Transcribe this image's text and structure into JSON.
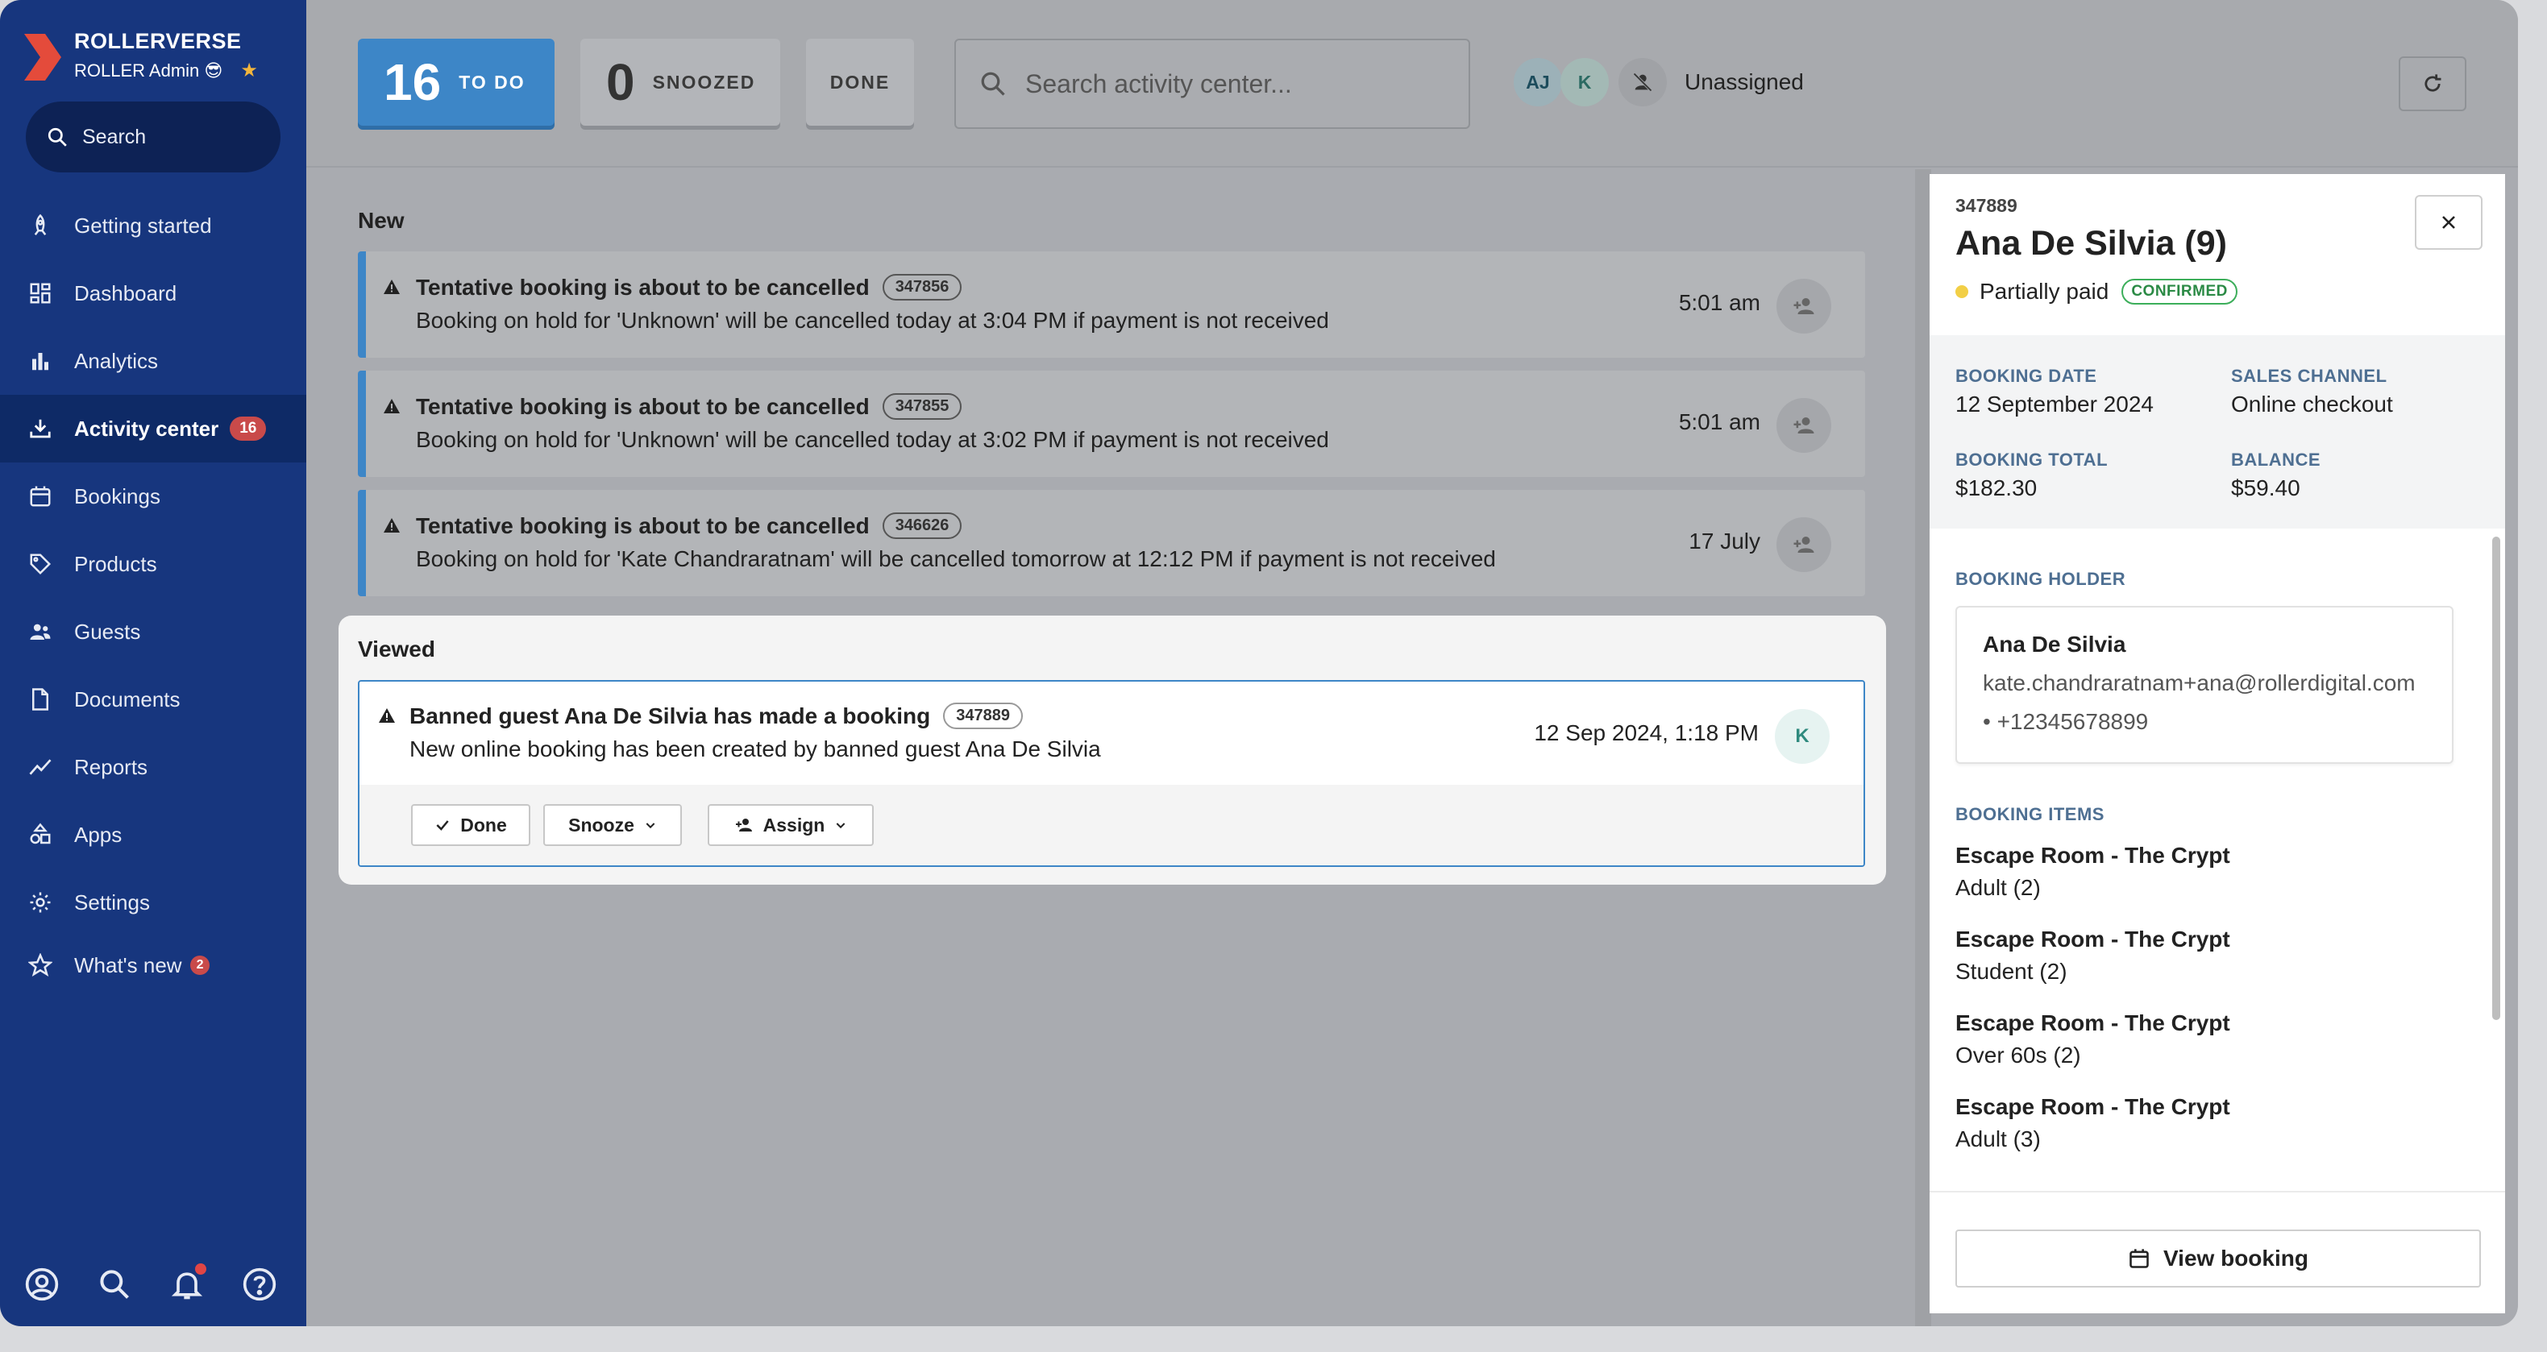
{
  "brand": {
    "name": "ROLLERVERSE",
    "role": "ROLLER Admin 😎",
    "star": "★",
    "accent": "#e44b3b"
  },
  "sidebar": {
    "search_label": "Search",
    "items": [
      {
        "label": "Getting started",
        "icon": "rocket-icon"
      },
      {
        "label": "Dashboard",
        "icon": "dashboard-icon"
      },
      {
        "label": "Analytics",
        "icon": "bar-chart-icon"
      },
      {
        "label": "Activity center",
        "icon": "download-tray-icon",
        "badge": "16",
        "active": true
      },
      {
        "label": "Bookings",
        "icon": "calendar-icon"
      },
      {
        "label": "Products",
        "icon": "tag-icon"
      },
      {
        "label": "Guests",
        "icon": "guests-icon"
      },
      {
        "label": "Documents",
        "icon": "document-icon"
      },
      {
        "label": "Reports",
        "icon": "trend-line-icon"
      },
      {
        "label": "Apps",
        "icon": "apps-icon"
      },
      {
        "label": "Settings",
        "icon": "gear-icon"
      },
      {
        "label": "What's new",
        "icon": "star-outline-icon",
        "badge": "2"
      }
    ],
    "bottom_icons": [
      "account-icon",
      "search-icon",
      "bell-icon",
      "help-icon"
    ]
  },
  "toolbar": {
    "todo": {
      "count": "16",
      "label": "TO DO"
    },
    "snoozed": {
      "count": "0",
      "label": "SNOOZED"
    },
    "done": {
      "label": "DONE"
    },
    "search_placeholder": "Search activity center...",
    "avatars": [
      "AJ",
      "K"
    ],
    "unassigned_label": "Unassigned"
  },
  "sections": {
    "new_title": "New",
    "viewed_title": "Viewed"
  },
  "new_items": [
    {
      "title": "Tentative booking is about to be cancelled",
      "id": "347856",
      "desc": "Booking on hold for 'Unknown' will be cancelled today at 3:04 PM if payment is not received",
      "time": "5:01 am"
    },
    {
      "title": "Tentative booking is about to be cancelled",
      "id": "347855",
      "desc": "Booking on hold for 'Unknown' will be cancelled today at 3:02 PM if payment is not received",
      "time": "5:01 am"
    },
    {
      "title": "Tentative booking is about to be cancelled",
      "id": "346626",
      "desc": "Booking on hold for 'Kate Chandraratnam' will be cancelled tomorrow at 12:12 PM if payment is not received",
      "time": "17 July"
    }
  ],
  "viewed_item": {
    "title": "Banned guest Ana De Silvia has made a booking",
    "id": "347889",
    "desc": "New online booking has been created by banned guest Ana De Silvia",
    "time": "12 Sep 2024, 1:18 PM",
    "assignee": "K",
    "actions": {
      "done": "Done",
      "snooze": "Snooze",
      "assign": "Assign"
    }
  },
  "panel": {
    "id": "347889",
    "name": "Ana De Silvia (9)",
    "payment_status": "Partially paid",
    "booking_status": "CONFIRMED",
    "summary": {
      "booking_date_label": "BOOKING DATE",
      "booking_date": "12 September 2024",
      "sales_channel_label": "SALES CHANNEL",
      "sales_channel": "Online checkout",
      "booking_total_label": "BOOKING TOTAL",
      "booking_total": "$182.30",
      "balance_label": "BALANCE",
      "balance": "$59.40"
    },
    "holder_label": "BOOKING HOLDER",
    "holder": {
      "name": "Ana De Silvia",
      "email": "kate.chandraratnam+ana@rollerdigital.com",
      "phone": "• +12345678899"
    },
    "items_label": "BOOKING ITEMS",
    "items": [
      {
        "name": "Escape Room - The Crypt",
        "detail": "Adult (2)"
      },
      {
        "name": "Escape Room - The Crypt",
        "detail": "Student (2)"
      },
      {
        "name": "Escape Room - The Crypt",
        "detail": "Over 60s (2)"
      },
      {
        "name": "Escape Room - The Crypt",
        "detail": "Adult (3)"
      }
    ],
    "view_booking_label": "View booking"
  },
  "colors": {
    "sidebar": "#17367e",
    "primary": "#3d86c7",
    "badge": "#c94a4a",
    "confirmed": "#3cae5a"
  }
}
